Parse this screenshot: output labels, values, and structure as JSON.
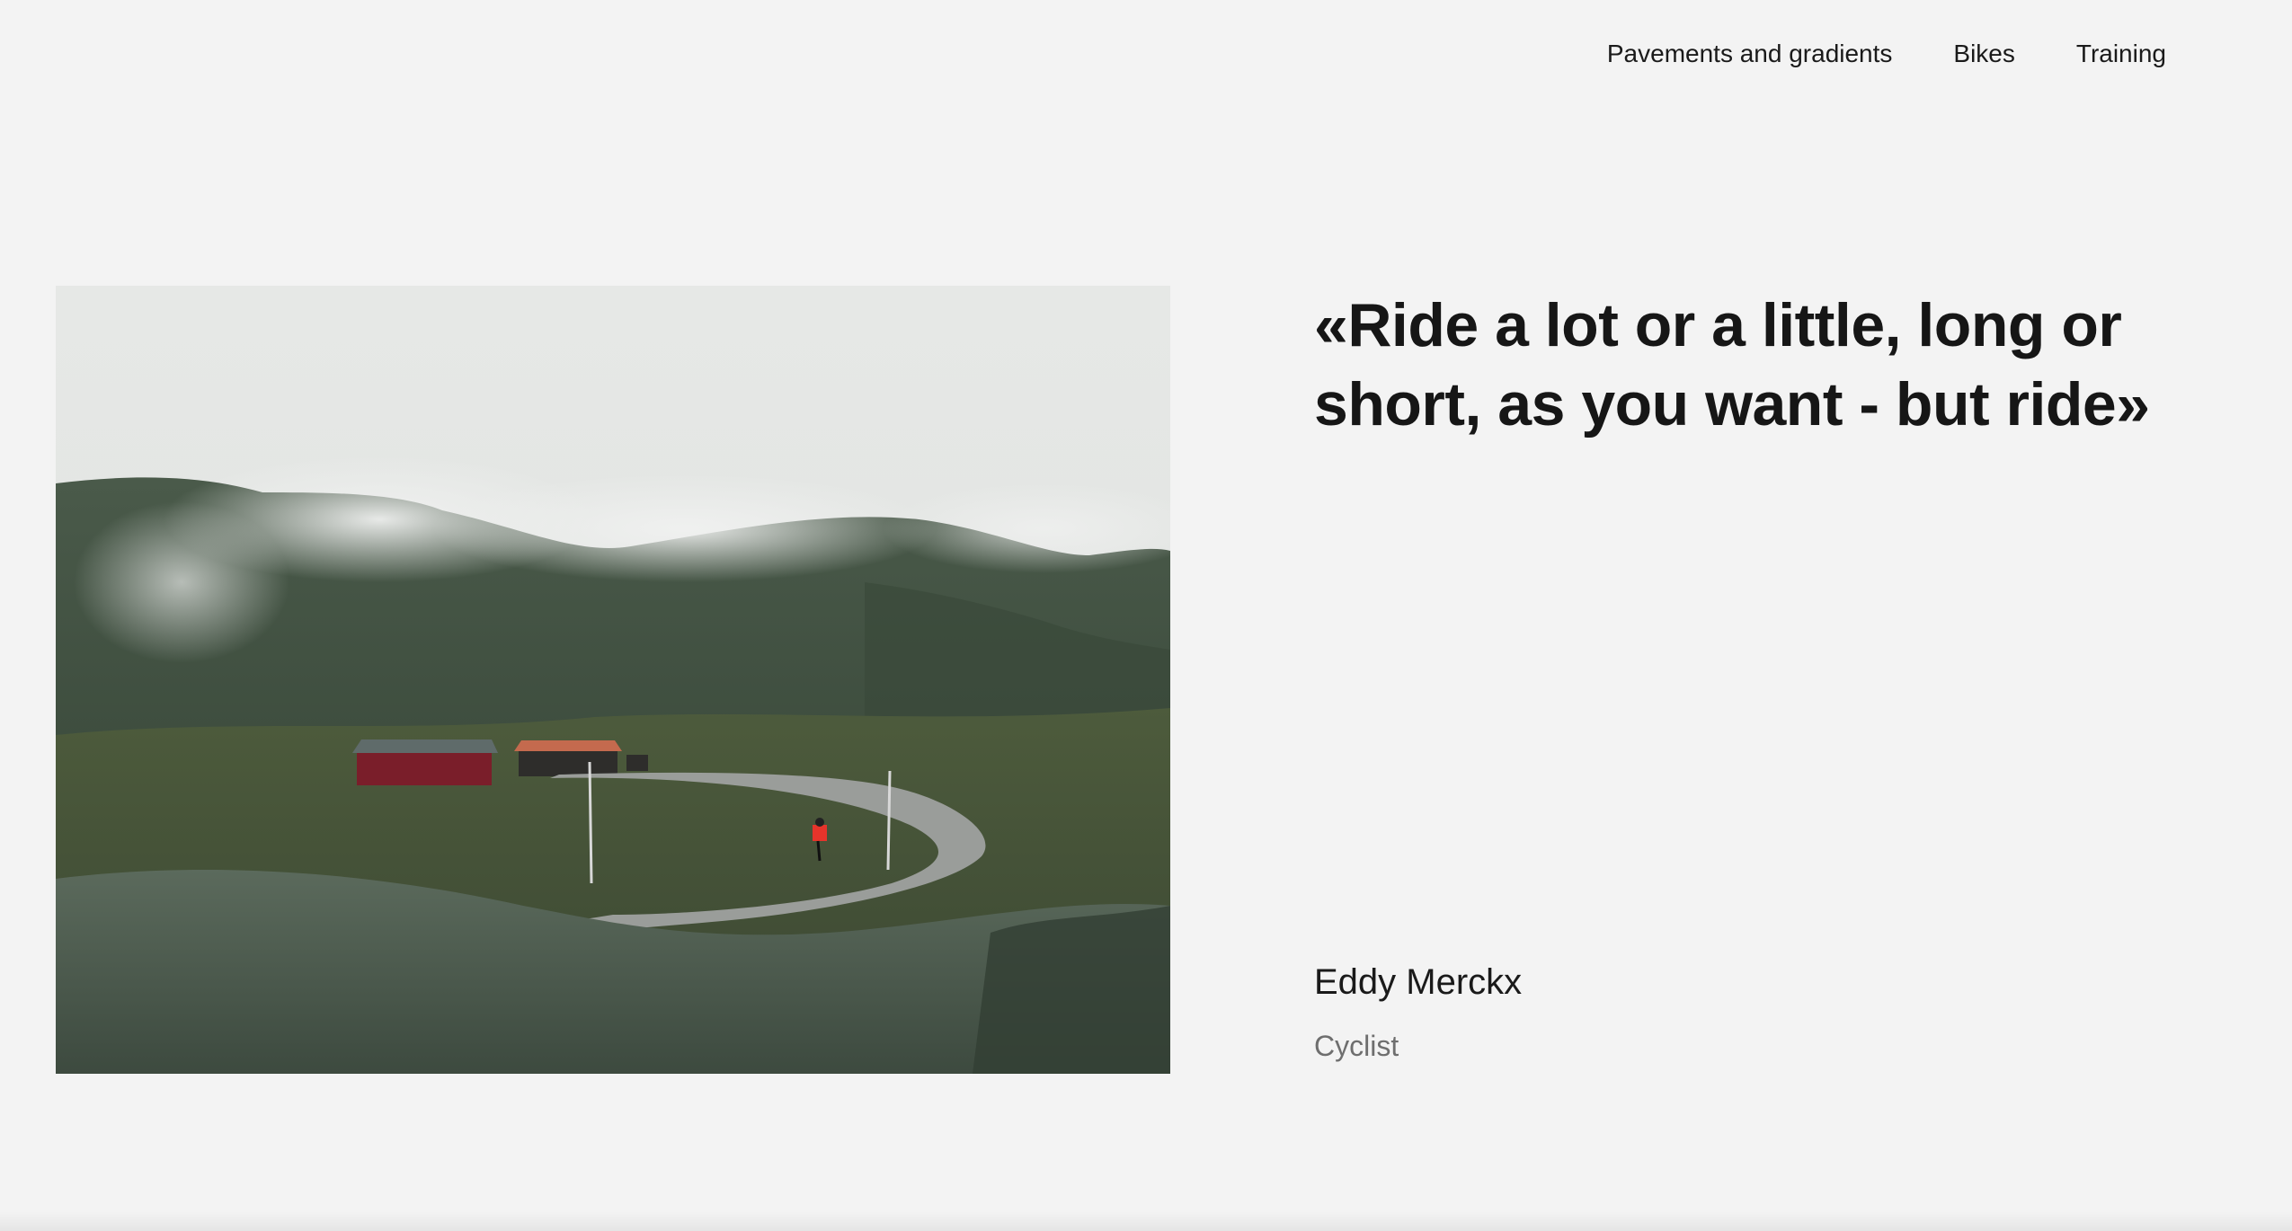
{
  "nav": {
    "items": [
      {
        "label": "Pavements and gradients"
      },
      {
        "label": "Bikes"
      },
      {
        "label": "Training"
      }
    ]
  },
  "hero": {
    "quote": "«Ride a lot or a little, long or short, as you want - but ride»",
    "author": "Eddy Merckx",
    "role": "Cyclist"
  },
  "colors": {
    "background": "#f3f3f3",
    "text": "#1a1a1a",
    "muted": "#6e6e6e"
  }
}
